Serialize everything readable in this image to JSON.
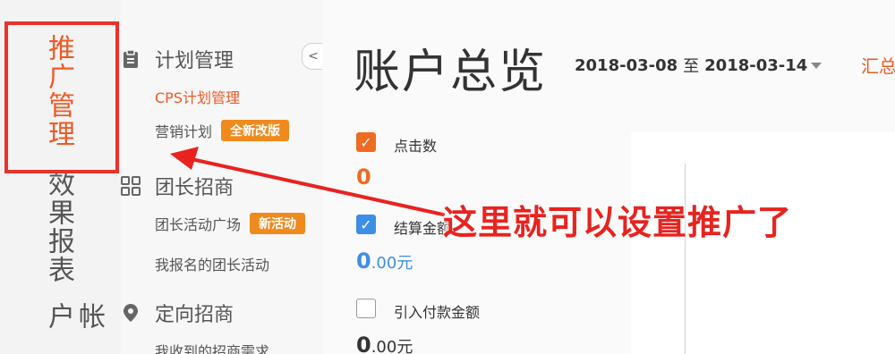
{
  "left_nav": {
    "active_label": "推广管理",
    "report_label": "效果报表",
    "account_label": "帐户"
  },
  "submenu": {
    "collapse_glyph": "<",
    "sections": [
      {
        "icon": "clipboard-icon",
        "title": "计划管理"
      },
      {
        "icon": "grid-icon",
        "title": "团长招商"
      },
      {
        "icon": "location-pin-icon",
        "title": "定向招商"
      }
    ],
    "items": [
      {
        "label": "CPS计划管理",
        "active": true
      },
      {
        "label": "营销计划",
        "badge": "全新改版"
      },
      {
        "label": "团长活动广场",
        "badge": "新活动"
      },
      {
        "label": "我报名的团长活动"
      },
      {
        "label": "我收到的招商需求"
      }
    ]
  },
  "main": {
    "title": "账户总览",
    "date_from": "2018-03-08",
    "date_sep": "至",
    "date_to": "2018-03-14",
    "summary_label": "汇总",
    "metrics": [
      {
        "label": "点击数",
        "value": "0",
        "checked": true,
        "color": "#ef6a22"
      },
      {
        "label": "结算金额",
        "value_int": "0",
        "value_dec": ".00元",
        "checked": true,
        "color": "#3d8ee6"
      },
      {
        "label": "引入付款金额",
        "value_int": "0",
        "value_dec": ".00元",
        "checked": false,
        "color": "#333333"
      }
    ]
  },
  "annotation": {
    "text": "这里就可以设置推广了",
    "color": "#e8231f"
  },
  "colors": {
    "accent": "#ef5a24",
    "highlight": "#e8322b",
    "badge": "#f08a1c"
  }
}
